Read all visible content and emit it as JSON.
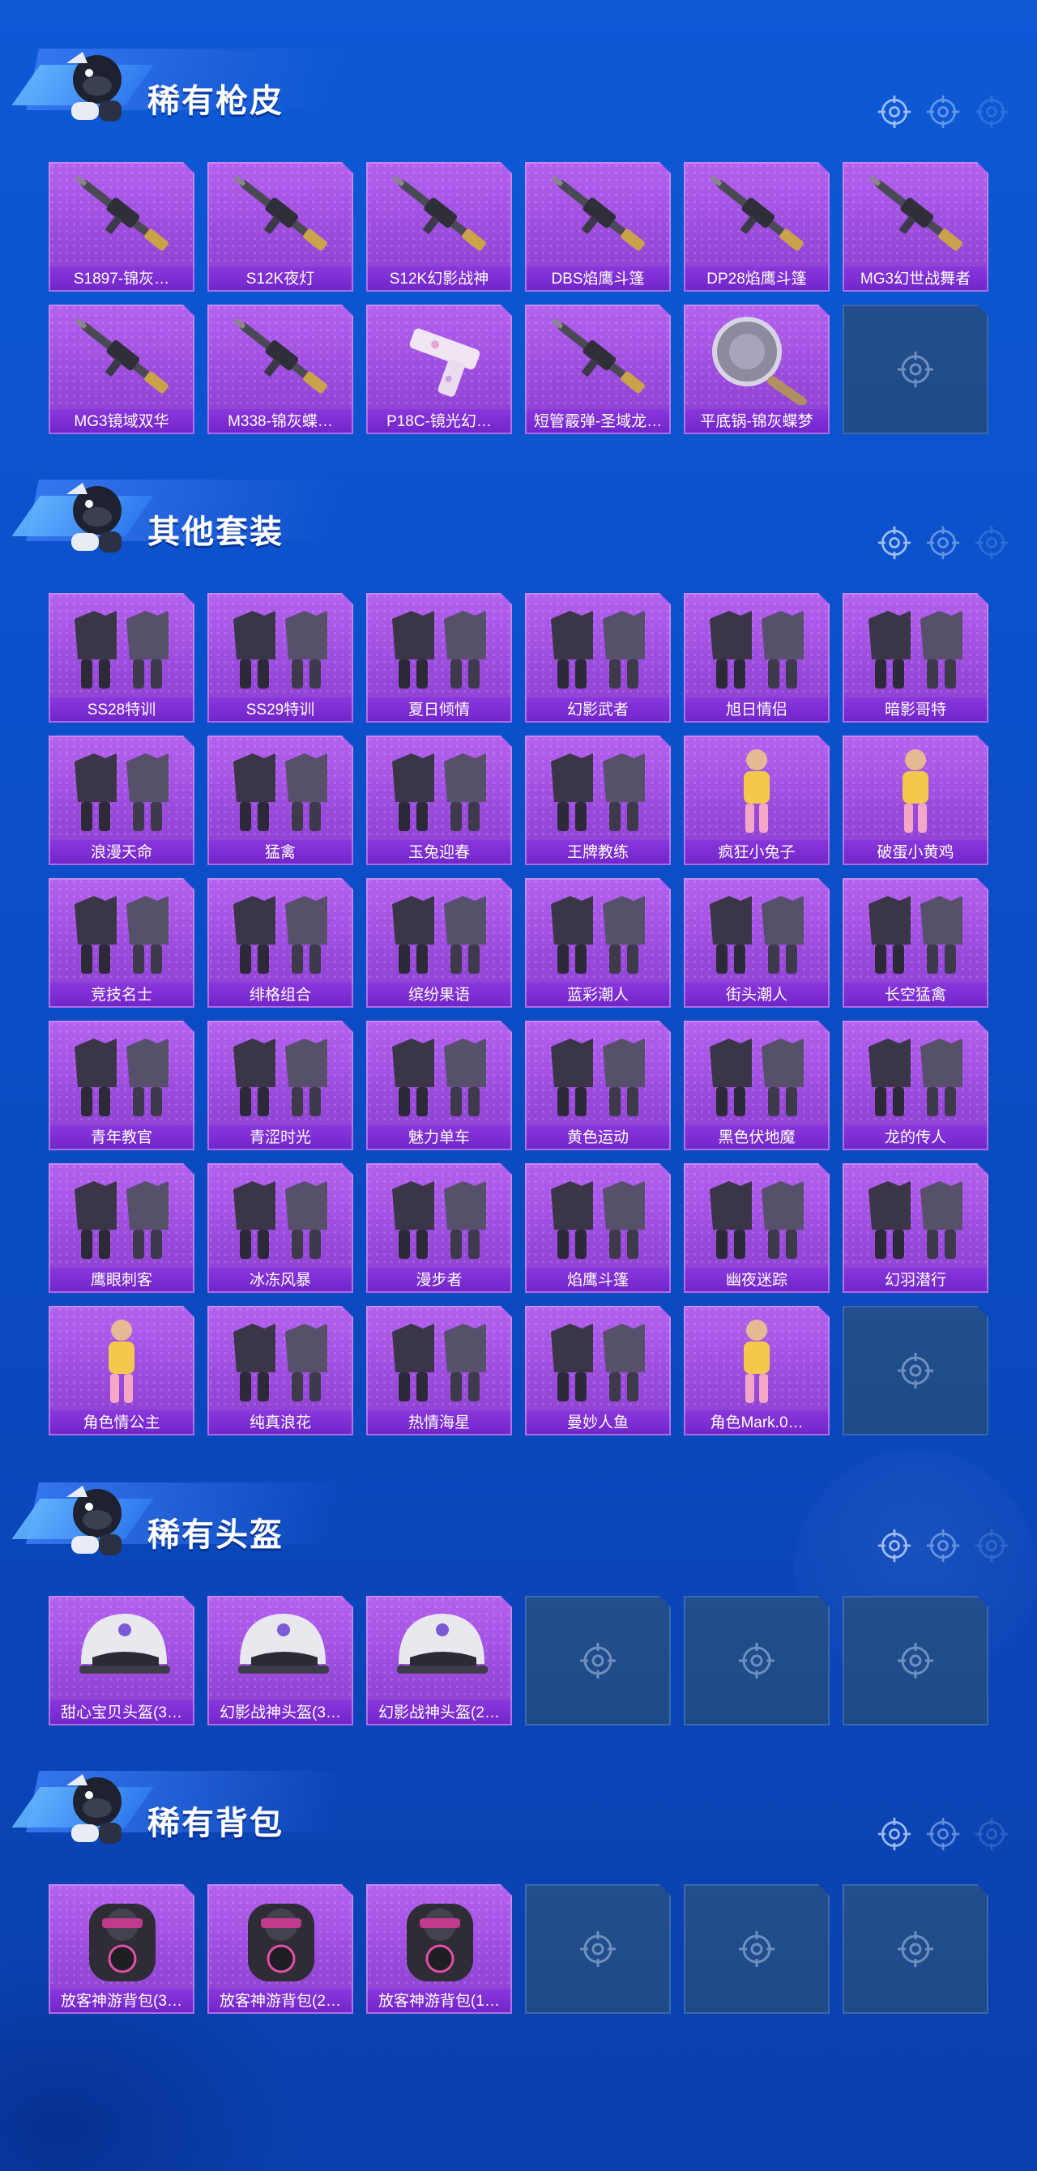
{
  "sections": [
    {
      "title": "稀有枪皮",
      "items": [
        "S1897-锦灰…",
        "S12K夜灯",
        "S12K幻影战神",
        "DBS焰鹰斗篷",
        "DP28焰鹰斗篷",
        "MG3幻世战舞者",
        "MG3镜域双华",
        "M338-锦灰蝶…",
        "P18C-镜光幻…",
        "短管霰弹-圣域龙…",
        "平底锅-锦灰蝶梦"
      ],
      "art": [
        "gun",
        "gun",
        "gun",
        "gun",
        "gun",
        "gun",
        "gun",
        "gun",
        "pistol",
        "gun",
        "pan"
      ],
      "empty_slots": 1
    },
    {
      "title": "其他套装",
      "items": [
        "SS28特训",
        "SS29特训",
        "夏日倾情",
        "幻影武者",
        "旭日情侣",
        "暗影哥特",
        "浪漫天命",
        "猛禽",
        "玉兔迎春",
        "王牌教练",
        "疯狂小兔子",
        "破蛋小黄鸡",
        "竞技名士",
        "绯格组合",
        "缤纷果语",
        "蓝彩潮人",
        "街头潮人",
        "长空猛禽",
        "青年教官",
        "青涩时光",
        "魅力单车",
        "黄色运动",
        "黑色伏地魔",
        "龙的传人",
        "鹰眼刺客",
        "冰冻风暴",
        "漫步者",
        "焰鹰斗篷",
        "幽夜迷踪",
        "幻羽潜行",
        "角色情公主",
        "纯真浪花",
        "热情海星",
        "曼妙人鱼",
        "角色Mark.0…"
      ],
      "art": [
        "outfit",
        "outfit",
        "outfit",
        "outfit",
        "outfit",
        "outfit",
        "outfit",
        "outfit",
        "outfit",
        "outfit",
        "character",
        "character",
        "outfit",
        "outfit",
        "outfit",
        "outfit",
        "outfit",
        "outfit",
        "outfit",
        "outfit",
        "outfit",
        "outfit",
        "outfit",
        "outfit",
        "outfit",
        "outfit",
        "outfit",
        "outfit",
        "outfit",
        "outfit",
        "character",
        "outfit",
        "outfit",
        "outfit",
        "character"
      ],
      "empty_slots": 1
    },
    {
      "title": "稀有头盔",
      "items": [
        "甜心宝贝头盔(3…",
        "幻影战神头盔(3…",
        "幻影战神头盔(2…"
      ],
      "art": [
        "helmet",
        "helmet",
        "helmet"
      ],
      "empty_slots": 3
    },
    {
      "title": "稀有背包",
      "items": [
        "放客神游背包(3…",
        "放客神游背包(2…",
        "放客神游背包(1…"
      ],
      "art": [
        "bag",
        "bag",
        "bag"
      ],
      "empty_slots": 3
    }
  ],
  "icons": {
    "mascot": "mascot-icon",
    "deco": "crosshair-icon",
    "empty": "crosshair-icon"
  },
  "colors": {
    "background": "#0b4fc9",
    "tile_purple": "#a655e6",
    "label_purple": "#7a2fd0",
    "empty_slot": "#214b8a"
  }
}
